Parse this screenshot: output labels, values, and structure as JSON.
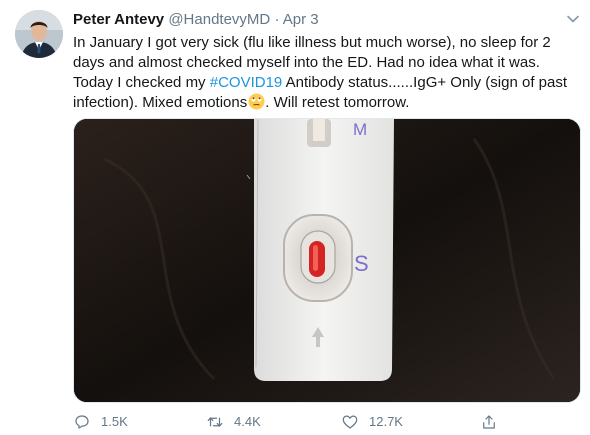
{
  "tweet": {
    "author_name": "Peter Antevy",
    "handle": "@HandtevyMD",
    "separator": "·",
    "date": "Apr 3",
    "text_before": "In January I got very sick (flu like illness but much worse), no sleep for 2 days and almost checked myself into the ED.  Had no idea what it was.  Today I checked my ",
    "hashtag": "#COVID19",
    "text_after": " Antibody status......IgG+ Only (sign of past infection). Mixed emotions",
    "emoji": "rolling-eyes-emoji",
    "text_end": ".  Will retest tomorrow.",
    "media": {
      "label_m": "M",
      "label_s": "S"
    },
    "actions": {
      "reply_count": "1.5K",
      "retweet_count": "4.4K",
      "like_count": "12.7K"
    }
  },
  "icons": [
    "avatar",
    "chevron-down-icon",
    "reply-icon",
    "retweet-icon",
    "like-icon",
    "share-icon"
  ],
  "colors": {
    "link": "#1b95e0",
    "muted": "#657786",
    "text": "#14171a",
    "test_label": "#7a6fd0",
    "test_line": "#d42424"
  }
}
